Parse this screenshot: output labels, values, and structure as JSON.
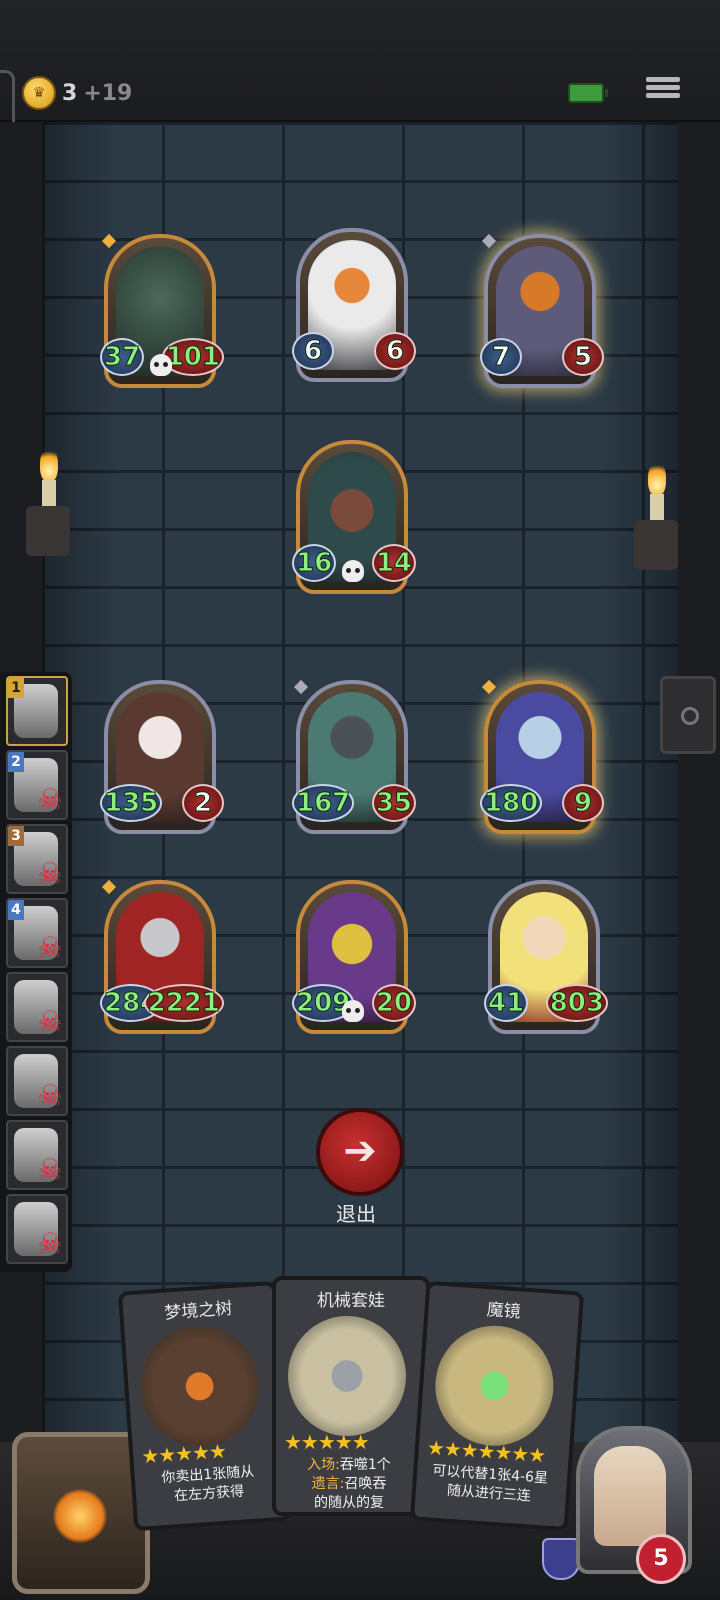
{
  "header": {
    "gold_count": "3",
    "gold_bonus": "+19",
    "icons": [
      "coin-icon",
      "battery-icon",
      "menu-icon"
    ]
  },
  "board": {
    "enemy_top": [
      {
        "name": "reaper-minion",
        "attack": "37",
        "health": "101",
        "frame": "gold",
        "buffed": true,
        "skull": true
      },
      {
        "name": "pumpkin-minion",
        "attack": "6",
        "health": "6",
        "frame": "silver",
        "buffed": false,
        "skull": false
      },
      {
        "name": "pumpkin-lock-minion",
        "attack": "7",
        "health": "5",
        "frame": "silver",
        "buffed": false,
        "skull": false
      }
    ],
    "enemy_mid": [
      {
        "name": "tentacle-beast-minion",
        "attack": "16",
        "health": "14",
        "frame": "gold",
        "buffed": true,
        "skull": true
      }
    ],
    "player_row1": [
      {
        "name": "rabbit-mask-minion",
        "attack": "135",
        "health": "2",
        "frame": "silver",
        "buffed": true,
        "skull": false
      },
      {
        "name": "iron-knight-minion",
        "attack": "167",
        "health": "35",
        "frame": "silver",
        "buffed": true,
        "skull": false
      },
      {
        "name": "sorceress-minion",
        "attack": "180",
        "health": "9",
        "frame": "gold",
        "buffed": true,
        "skull": false
      }
    ],
    "player_row2": [
      {
        "name": "helmeted-rogue-minion",
        "attack": "284",
        "health": "2221",
        "frame": "gold",
        "buffed": true,
        "skull": false
      },
      {
        "name": "robot-minion",
        "attack": "209",
        "health": "20",
        "frame": "gold",
        "buffed": true,
        "skull": true
      },
      {
        "name": "dwarf-warrior-minion",
        "attack": "41",
        "health": "803",
        "frame": "silver",
        "buffed": true,
        "skull": false
      }
    ]
  },
  "roster": [
    {
      "rank": "1",
      "eliminated": false
    },
    {
      "rank": "2",
      "eliminated": true
    },
    {
      "rank": "3",
      "eliminated": true
    },
    {
      "rank": "4",
      "eliminated": true
    },
    {
      "rank": "",
      "eliminated": true
    },
    {
      "rank": "",
      "eliminated": true
    },
    {
      "rank": "",
      "eliminated": true
    },
    {
      "rank": "",
      "eliminated": true
    }
  ],
  "exit": {
    "label": "退出"
  },
  "hand": [
    {
      "title": "梦境之树",
      "stars": "★★★★★",
      "desc_line1": "你卖出1张随从",
      "desc_line2": "在左方获得",
      "keyword1": "",
      "keyword2": ""
    },
    {
      "title": "机械套娃",
      "stars": "★★★★★",
      "desc_line1": "吞噬1个",
      "desc_line2": "召唤吞",
      "keyword1": "入场:",
      "keyword2": "遗言:",
      "desc_line3": "的随从的复"
    },
    {
      "title": "魔镜",
      "stars": "★★★★★★★",
      "desc_line1": "可以代替1张4-6星",
      "desc_line2": "随从进行三连",
      "keyword1": "",
      "keyword2": ""
    }
  ],
  "hero": {
    "health": "5"
  },
  "colors": {
    "buffed_stat": "#8ef07a",
    "gold_frame": "#c78a3a",
    "silver_frame": "#8b8ea6",
    "exit_red": "#c83030"
  }
}
